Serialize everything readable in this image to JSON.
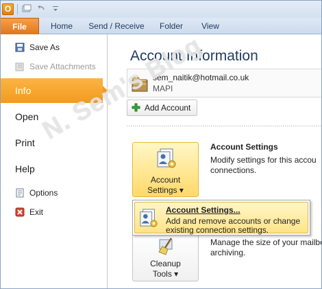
{
  "tabs": {
    "file": "File",
    "home": "Home",
    "send_receive": "Send / Receive",
    "folder": "Folder",
    "view": "View"
  },
  "nav": {
    "save_as": "Save As",
    "save_attachments": "Save Attachments",
    "info": "Info",
    "open": "Open",
    "print": "Print",
    "help": "Help",
    "options": "Options",
    "exit": "Exit"
  },
  "main": {
    "title": "Account Information",
    "account": {
      "email": "sem_naitik@hotmail.co.uk",
      "type": "MAPI"
    },
    "add_account": "Add Account",
    "account_settings": {
      "button_line1": "Account",
      "button_line2": "Settings ▾",
      "heading": "Account Settings",
      "description": "Modify settings for this accou connections."
    },
    "cleanup": {
      "button_line1": "Cleanup",
      "button_line2": "Tools ▾",
      "description": "Manage the size of your mailbo archiving."
    }
  },
  "dropdown": {
    "title": "Account Settings...",
    "description": "Add and remove accounts or change existing connection settings."
  },
  "watermark": "N. Sem's Blog",
  "colors": {
    "accent_orange": "#f39a1d",
    "ribbon_blue": "#dfe9f5",
    "file_tab": "#e0761a",
    "hover_yellow": "#ffe488"
  }
}
